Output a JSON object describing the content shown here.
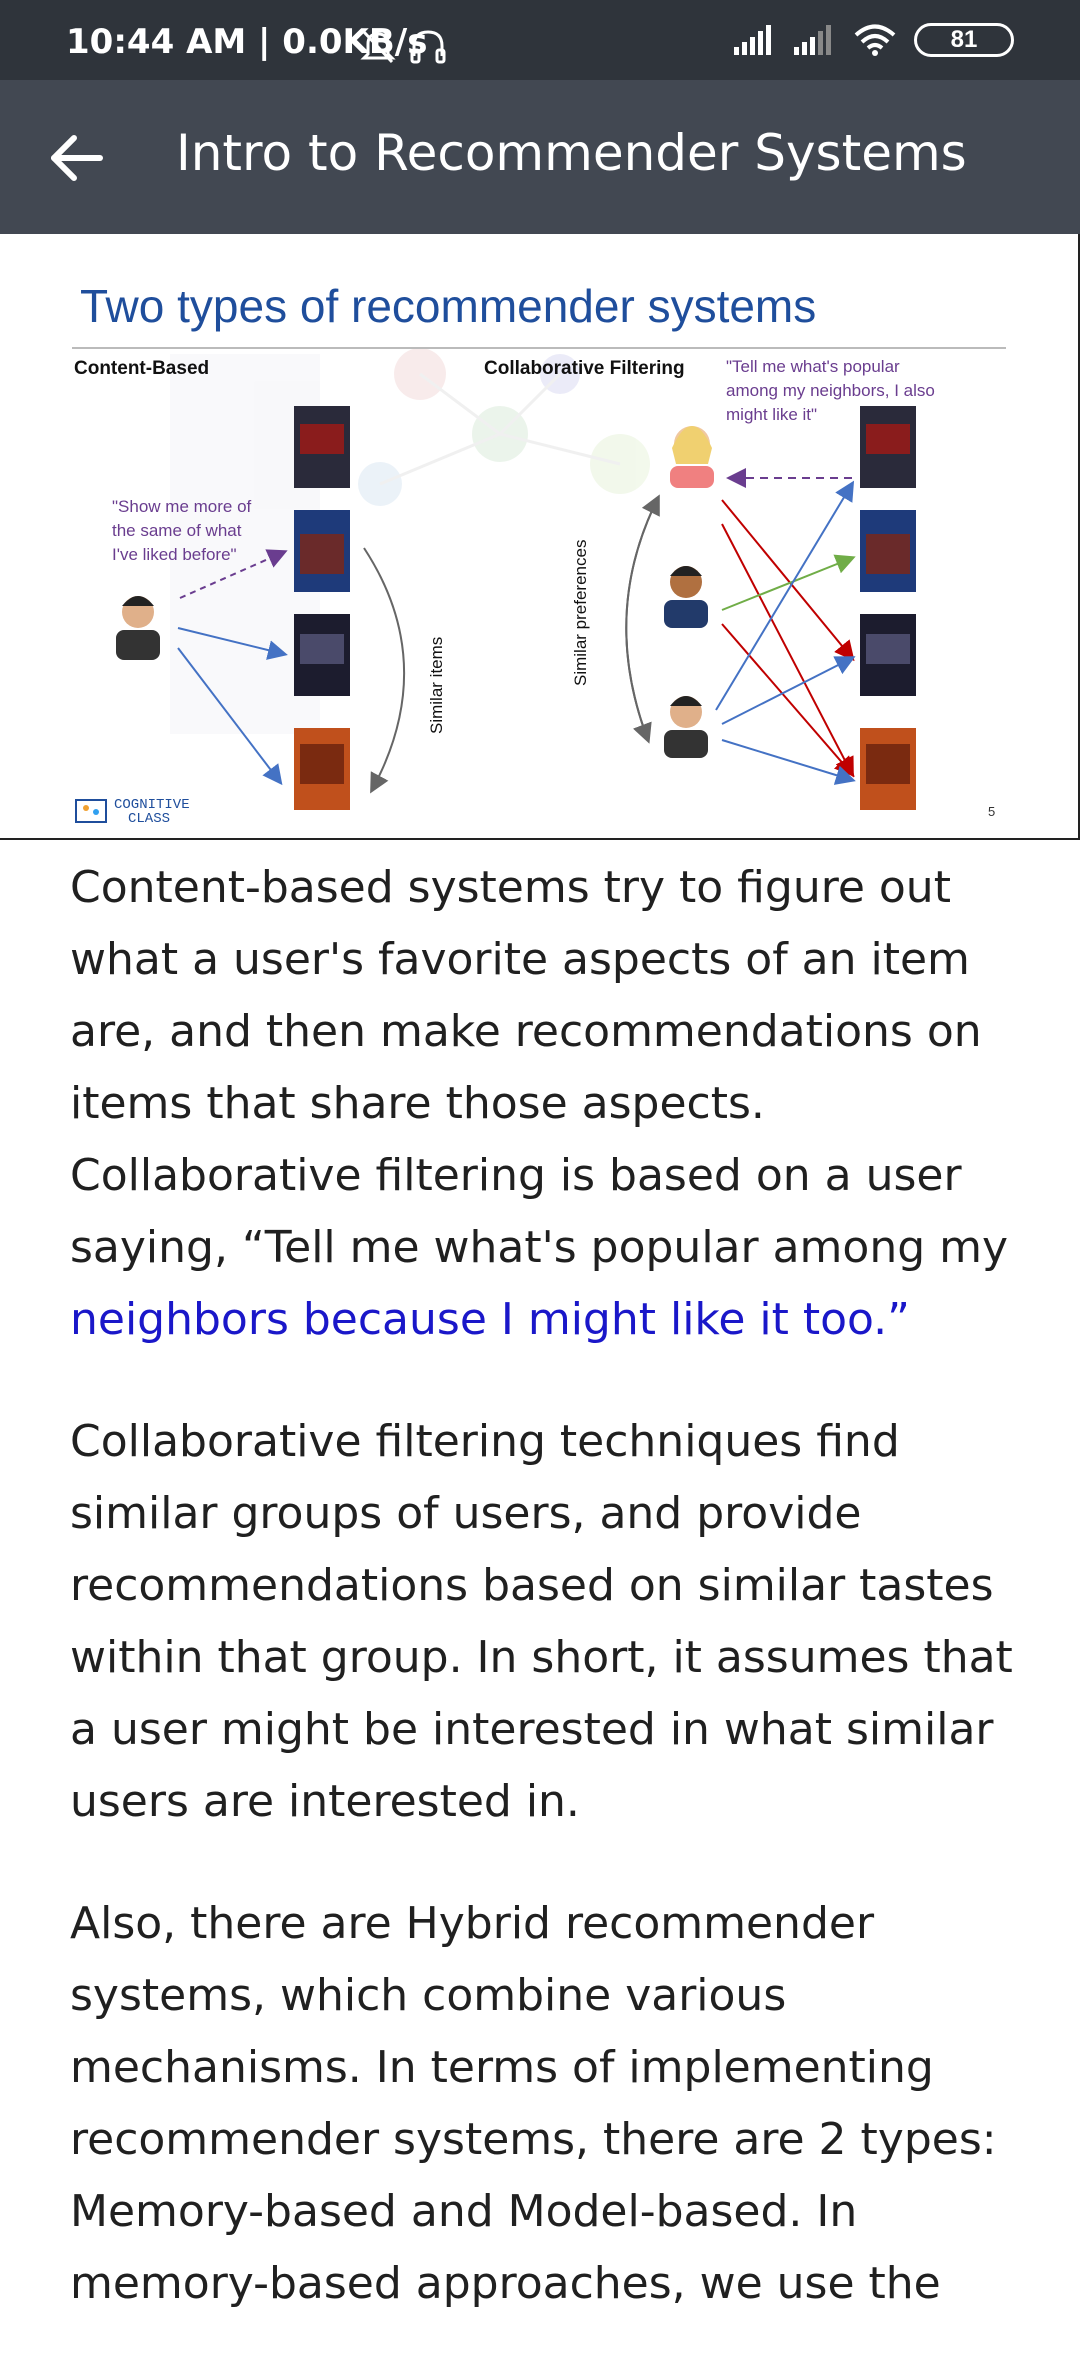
{
  "status_bar": {
    "time_text": "10:44 AM | 0.0KB/s",
    "battery": "81",
    "icons": [
      "mute-icon",
      "headset-icon",
      "signal-icon",
      "signal-icon",
      "wifi-icon",
      "battery-icon"
    ]
  },
  "app_bar": {
    "title": "Intro to Recommender Systems",
    "back_icon": "arrow-left-icon"
  },
  "slide": {
    "title": "Two types of recommender systems",
    "left_heading": "Content-Based",
    "right_heading": "Collaborative Filtering",
    "left_quote": [
      "\"Show me more of",
      "the same of what",
      "I've liked before\""
    ],
    "right_quote": [
      "\"Tell me what's popular",
      "among my neighbors, I also",
      "might like it\""
    ],
    "similar_items": "Similar items",
    "similar_preferences": "Similar preferences",
    "logo_text_1": "COGNITIVE",
    "logo_text_2": "CLASS",
    "page_number": "5",
    "colors": {
      "title": "#1f4e9c",
      "quote": "#6a3d8f",
      "arrow_blue": "#4472c4",
      "arrow_red": "#c00000",
      "arrow_green": "#70ad47",
      "dashed": "#6a3d8f"
    }
  },
  "article": {
    "paragraph1_main": "Content-based systems try to figure out what a user's favorite aspects of an item are, and then make recommendations on items that share those aspects. Collaborative filtering is based on a user saying, “Tell me what's popular among my",
    "paragraph1_link": "neighbors because I might like it too.”",
    "paragraph2": "Collaborative filtering techniques find similar groups of users, and provide recommendations based on similar tastes within that group. In short, it assumes that a user might be interested in what similar users are interested in.",
    "paragraph3": "Also, there are Hybrid recommender systems, which combine various mechanisms. In terms of implementing recommender systems, there are 2 types: Memory-based and Model-based. In memory-based approaches, we use the"
  }
}
